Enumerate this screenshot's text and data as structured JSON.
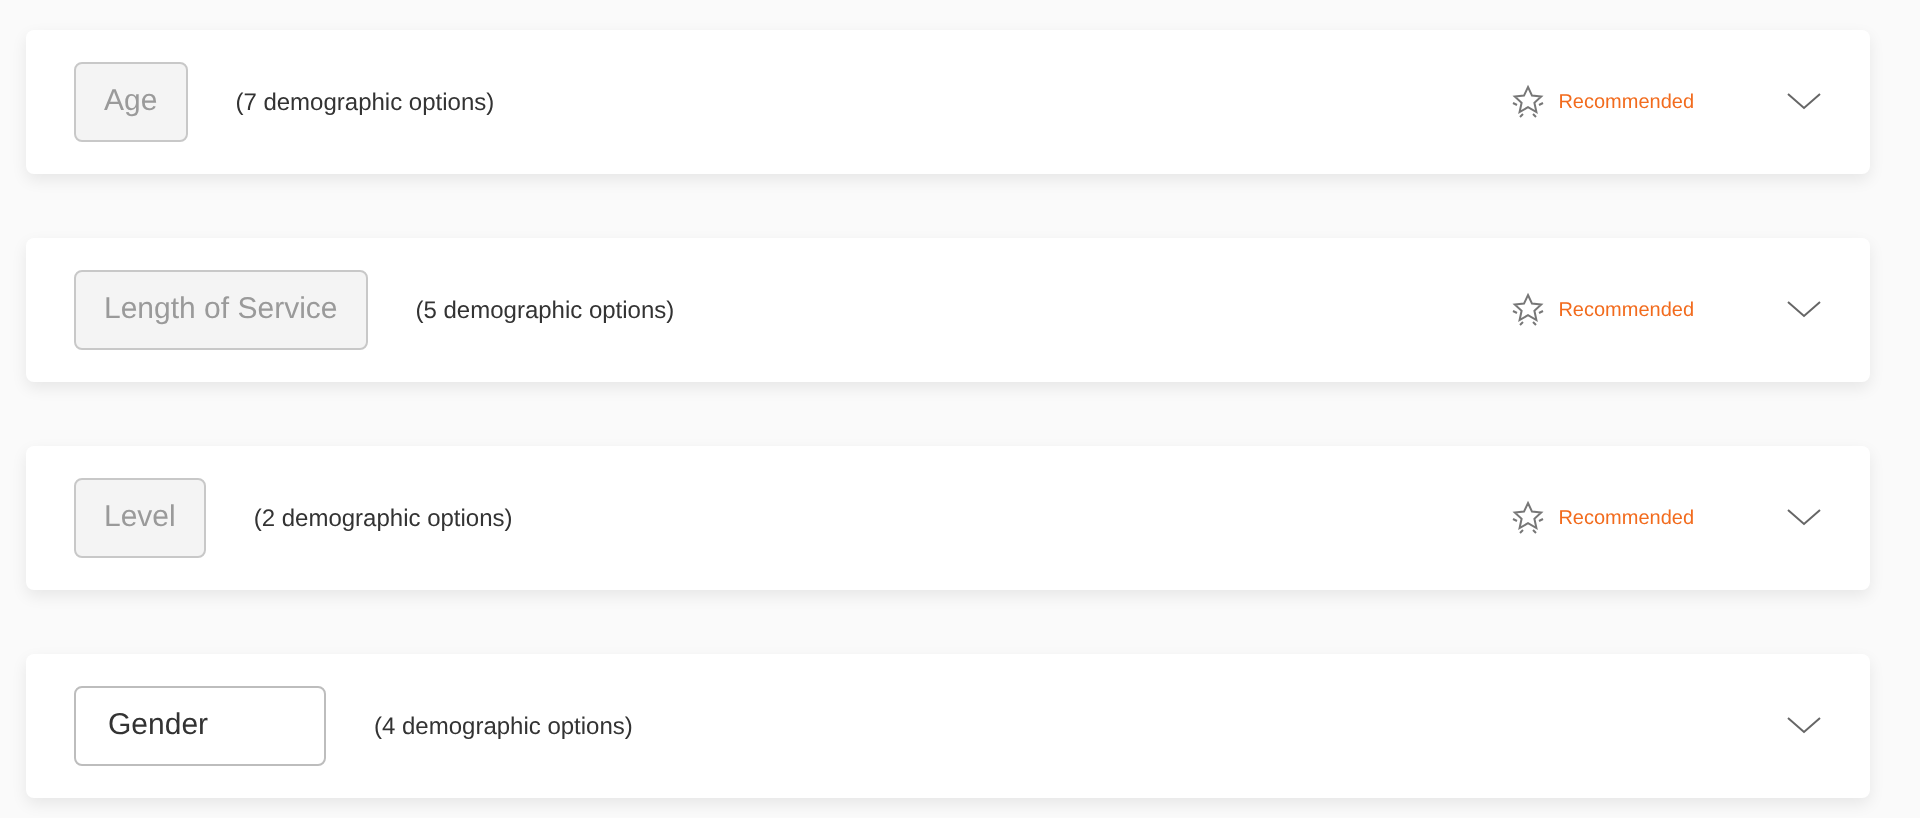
{
  "demographics": [
    {
      "label": "Age",
      "options": "(7 demographic options)",
      "disabled": true,
      "recommended": true,
      "recommended_label": "Recommended",
      "expanded": false
    },
    {
      "label": "Length of Service",
      "options": "(5 demographic options)",
      "disabled": true,
      "recommended": true,
      "recommended_label": "Recommended",
      "expanded": false
    },
    {
      "label": "Level",
      "options": "(2 demographic options)",
      "disabled": true,
      "recommended": true,
      "recommended_label": "Recommended",
      "expanded": false
    },
    {
      "label": "Gender",
      "options": "(4 demographic options)",
      "disabled": false,
      "recommended": false,
      "expanded": false
    }
  ]
}
